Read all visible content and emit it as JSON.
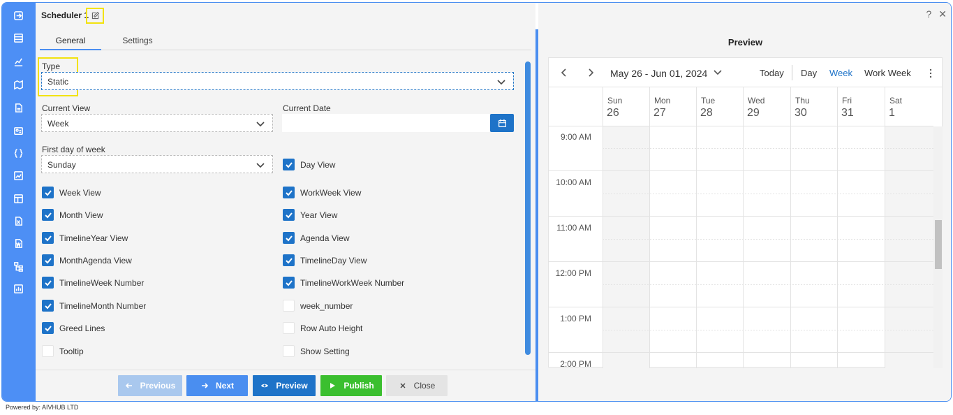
{
  "window": {
    "title": "Scheduler 1",
    "help": "?",
    "close": "✕"
  },
  "tabs": [
    {
      "label": "General"
    },
    {
      "label": "Settings"
    }
  ],
  "form": {
    "type_label": "Type",
    "type_value": "Static",
    "current_view_label": "Current View",
    "current_view_value": "Week",
    "current_date_label": "Current Date",
    "current_date_value": "",
    "first_day_label": "First day of week",
    "first_day_value": "Sunday",
    "checkboxes": [
      {
        "label": "Day View",
        "checked": true
      },
      {
        "label": "Week View",
        "checked": true
      },
      {
        "label": "WorkWeek View",
        "checked": true
      },
      {
        "label": "Month View",
        "checked": true
      },
      {
        "label": "Year View",
        "checked": true
      },
      {
        "label": "TimelineYear View",
        "checked": true
      },
      {
        "label": "Agenda View",
        "checked": true
      },
      {
        "label": "MonthAgenda View",
        "checked": true
      },
      {
        "label": "TimelineDay View",
        "checked": true
      },
      {
        "label": "TimelineWeek Number",
        "checked": true
      },
      {
        "label": "TimelineWorkWeek Number",
        "checked": true
      },
      {
        "label": "TimelineMonth Number",
        "checked": true
      },
      {
        "label": "week_number",
        "checked": false
      },
      {
        "label": "Greed Lines",
        "checked": true
      },
      {
        "label": "Row Auto Height",
        "checked": false
      },
      {
        "label": "Tooltip",
        "checked": false
      },
      {
        "label": "Show Setting",
        "checked": false
      }
    ]
  },
  "footer": {
    "previous": "Previous",
    "next": "Next",
    "preview": "Preview",
    "publish": "Publish",
    "close": "Close"
  },
  "preview": {
    "title": "Preview",
    "date_range": "May 26 - Jun 01, 2024",
    "today": "Today",
    "views": [
      "Day",
      "Week",
      "Work Week"
    ],
    "active_view": "Week",
    "days": [
      {
        "name": "Sun",
        "date": "26"
      },
      {
        "name": "Mon",
        "date": "27"
      },
      {
        "name": "Tue",
        "date": "28"
      },
      {
        "name": "Wed",
        "date": "29"
      },
      {
        "name": "Thu",
        "date": "30"
      },
      {
        "name": "Fri",
        "date": "31"
      },
      {
        "name": "Sat",
        "date": "1"
      }
    ],
    "times": [
      "9:00 AM",
      "10:00 AM",
      "11:00 AM",
      "12:00 PM",
      "1:00 PM",
      "2:00 PM"
    ]
  },
  "powered_by": "Powered by: AIVHUB LTD",
  "colors": {
    "rail": "#4d8ff5",
    "primary": "#1e73c8",
    "publish": "#3bbf2f",
    "highlight": "#f2e20e"
  }
}
